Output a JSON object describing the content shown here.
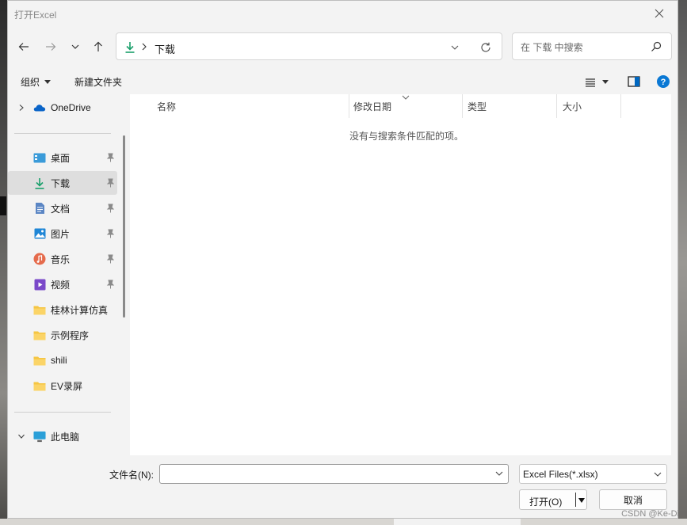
{
  "dialog": {
    "title": "打开Excel"
  },
  "address": {
    "crumb": "下载"
  },
  "search": {
    "placeholder": "在 下载 中搜索"
  },
  "toolbar": {
    "organize": "组织",
    "new_folder": "新建文件夹"
  },
  "sidebar": {
    "onedrive": "OneDrive",
    "items": [
      {
        "label": "桌面",
        "icon": "desktop-icon"
      },
      {
        "label": "下载",
        "icon": "download-icon"
      },
      {
        "label": "文档",
        "icon": "document-icon"
      },
      {
        "label": "图片",
        "icon": "pictures-icon"
      },
      {
        "label": "音乐",
        "icon": "music-icon"
      },
      {
        "label": "视频",
        "icon": "video-icon"
      },
      {
        "label": "桂林计算仿真",
        "icon": "folder-icon"
      },
      {
        "label": "示例程序",
        "icon": "folder-icon"
      },
      {
        "label": "shili",
        "icon": "folder-icon"
      },
      {
        "label": "EV录屏",
        "icon": "folder-icon"
      }
    ],
    "this_pc": "此电脑"
  },
  "columns": {
    "name": "名称",
    "modified": "修改日期",
    "type": "类型",
    "size": "大小"
  },
  "empty_message": "没有与搜索条件匹配的项。",
  "bottom": {
    "filename_label": "文件名(N):",
    "filename_value": "",
    "filetype": "Excel Files(*.xlsx)",
    "open": "打开(O)",
    "cancel": "取消"
  },
  "watermark": "CSDN @Ke-Di",
  "colors": {
    "accent": "#0067c0",
    "folder": "#f5c542",
    "download": "#1a9f6b"
  }
}
